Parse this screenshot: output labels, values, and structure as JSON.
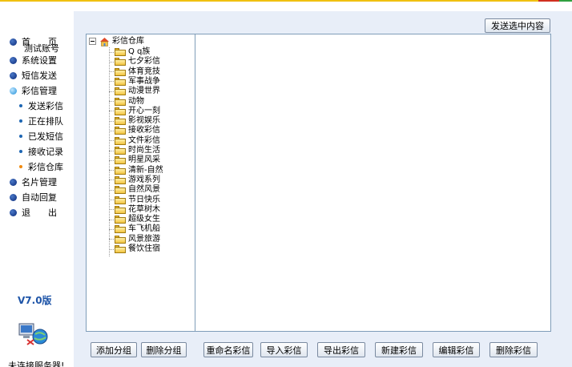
{
  "sidebar": {
    "home": "首　　页",
    "account": "测试账号",
    "items": [
      "系统设置",
      "短信发送",
      "彩信管理"
    ],
    "mms_sub": [
      "发送彩信",
      "正在排队",
      "已发短信",
      "接收记录",
      "彩信仓库"
    ],
    "items2": [
      "名片管理",
      "自动回复",
      "退　　出"
    ],
    "version": "V7.0版",
    "status": "未连接服务器!"
  },
  "toolbar": {
    "send_selected": "发送选中内容"
  },
  "tree": {
    "root": "彩信仓库",
    "folders": [
      "Q q族",
      "七夕彩信",
      "体育竞技",
      "军事战争",
      "动漫世界",
      "动物",
      "开心一刻",
      "影视娱乐",
      "接收彩信",
      "文件彩信",
      "时尚生活",
      "明星风采",
      "清新-自然",
      "游戏系列",
      "自然风景",
      "节日快乐",
      "花草树木",
      "超级女生",
      "车飞机船",
      "风景旅游",
      "餐饮住宿"
    ]
  },
  "buttons": {
    "add_group": "添加分组",
    "delete_group": "删除分组",
    "rename": "重命名彩信",
    "import": "导入彩信",
    "export": "导出彩信",
    "new": "新建彩信",
    "edit": "编辑彩信",
    "delete": "删除彩信"
  },
  "colors": {
    "accent_blue": "#1f55a8",
    "panel_bg": "#e8eef8",
    "current_dot": "#f08a10"
  },
  "icons": {
    "root": "home-icon",
    "folder": "folder-icon",
    "connection": "network-computer-icon",
    "nav_bullet": "blue-ball-icon"
  }
}
